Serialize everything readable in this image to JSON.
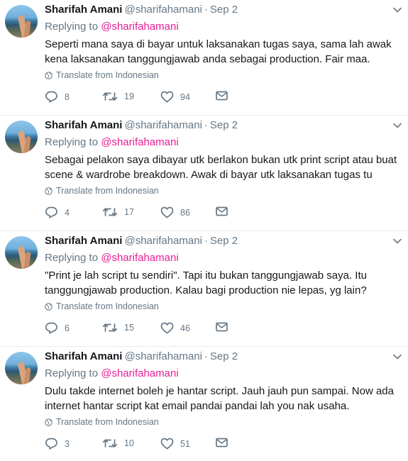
{
  "tweets": [
    {
      "name": "Sharifah Amani",
      "handle": "@sharifahamani",
      "separator": "·",
      "date": "Sep 2",
      "replying_prefix": "Replying to",
      "replying_handle": "@sharifahamani",
      "text": "Seperti mana saya di bayar untuk laksanakan tugas saya, sama lah awak kena laksanakan tanggungjawab anda sebagai production. Fair maa.",
      "translate": "Translate from Indonesian",
      "replies": "8",
      "retweets": "19",
      "likes": "94"
    },
    {
      "name": "Sharifah Amani",
      "handle": "@sharifahamani",
      "separator": "·",
      "date": "Sep 2",
      "replying_prefix": "Replying to",
      "replying_handle": "@sharifahamani",
      "text": "Sebagai pelakon saya dibayar utk berlakon bukan utk print script atau buat scene & wardrobe breakdown. Awak di bayar utk laksanakan tugas tu",
      "translate": "Translate from Indonesian",
      "replies": "4",
      "retweets": "17",
      "likes": "86"
    },
    {
      "name": "Sharifah Amani",
      "handle": "@sharifahamani",
      "separator": "·",
      "date": "Sep 2",
      "replying_prefix": "Replying to",
      "replying_handle": "@sharifahamani",
      "text": "\"Print je lah script tu sendiri\". Tapi itu bukan tanggungjawab saya. Itu tanggungjawab production. Kalau bagi production nie lepas, yg lain?",
      "translate": "Translate from Indonesian",
      "replies": "6",
      "retweets": "15",
      "likes": "46"
    },
    {
      "name": "Sharifah Amani",
      "handle": "@sharifahamani",
      "separator": "·",
      "date": "Sep 2",
      "replying_prefix": "Replying to",
      "replying_handle": "@sharifahamani",
      "text": "Dulu takde internet boleh je hantar script. Jauh jauh pun sampai. Now ada internet hantar script kat email pandai pandai lah you nak usaha.",
      "translate": "Translate from Indonesian",
      "replies": "3",
      "retweets": "10",
      "likes": "51"
    }
  ],
  "icons": {
    "reply": "reply-icon",
    "retweet": "retweet-icon",
    "like": "heart-icon",
    "dm": "envelope-icon",
    "translate": "globe-icon",
    "menu": "chevron-down-icon"
  },
  "colors": {
    "mention": "#e81c96",
    "secondary_text": "#657786",
    "divider": "#e6ecf0"
  }
}
